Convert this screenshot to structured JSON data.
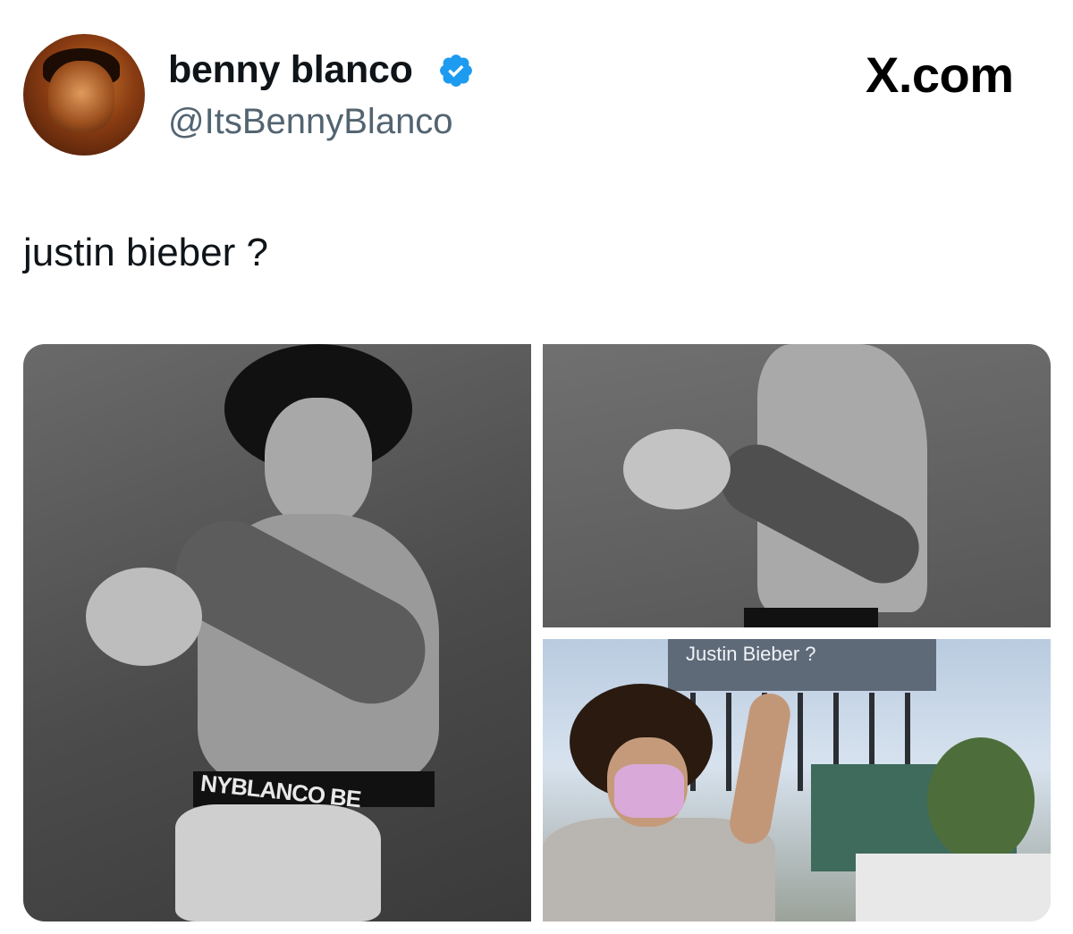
{
  "author": {
    "display_name": "benny blanco",
    "handle": "@ItsBennyBlanco",
    "verified": true
  },
  "brand": {
    "mark": "X.com"
  },
  "tweet": {
    "text": "justin bieber ?"
  },
  "media": {
    "left_waistband_text": "NYBLANCO  BE",
    "billboard_text": "Justin      Bieber ?"
  },
  "colors": {
    "text_primary": "#0f1419",
    "text_secondary": "#536471",
    "verified_blue": "#1d9bf0"
  }
}
